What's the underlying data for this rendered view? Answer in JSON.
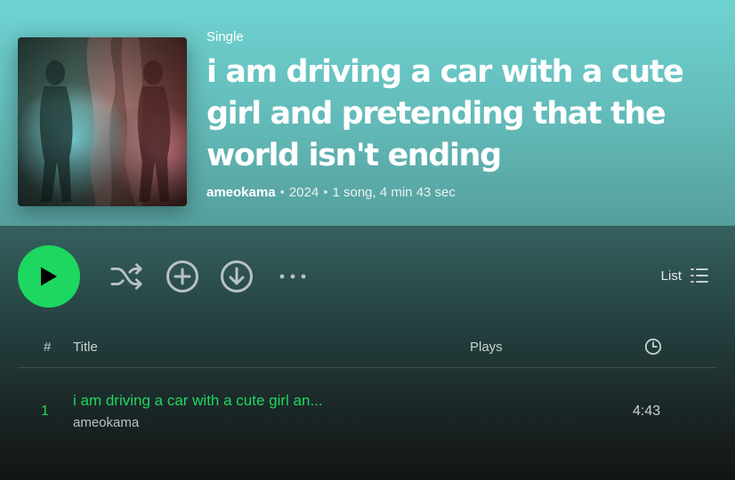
{
  "header": {
    "type_label": "Single",
    "title": "i am driving a car with a cute girl and pretending that the world isn't ending",
    "artist": "ameokama",
    "year": "2024",
    "summary": "1 song, 4 min 43 sec"
  },
  "controls": {
    "play_icon": "play-icon",
    "shuffle_icon": "shuffle-icon",
    "add_icon": "add-circle-icon",
    "download_icon": "download-icon",
    "more_icon": "more-icon",
    "view_label": "List",
    "accent_color": "#1ed760"
  },
  "tracklist": {
    "columns": {
      "number": "#",
      "title": "Title",
      "plays": "Plays",
      "duration_icon": "clock-icon"
    },
    "tracks": [
      {
        "number": "1",
        "title": "i am driving a car with a cute girl an...",
        "artist": "ameokama",
        "plays": "",
        "duration": "4:43"
      }
    ]
  }
}
